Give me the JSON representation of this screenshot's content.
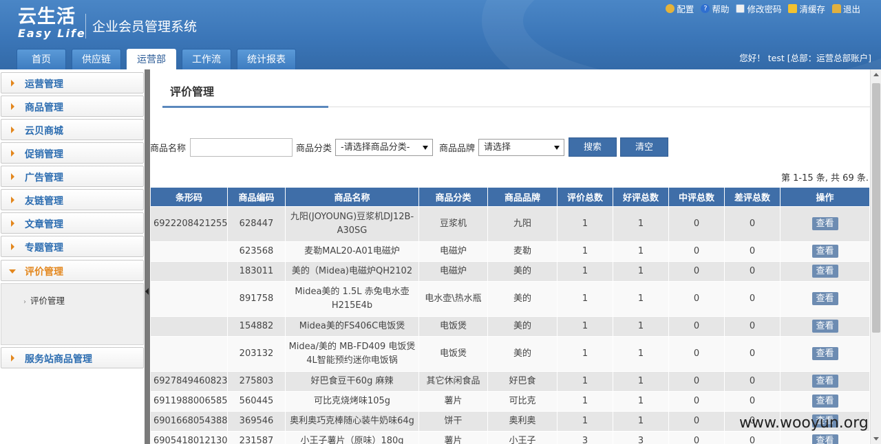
{
  "header": {
    "logo_cn": "云生活",
    "logo_en": "Easy Life",
    "system_title": "企业会员管理系统",
    "toplinks": [
      "配置",
      "帮助",
      "修改密码",
      "清缓存",
      "退出"
    ],
    "greeting": "您好！ test [总部：运营总部账户]",
    "tabs": [
      "首页",
      "供应链",
      "运营部",
      "工作流",
      "统计报表"
    ],
    "active_tab": "运营部"
  },
  "sidebar": {
    "items": [
      "运营管理",
      "商品管理",
      "云贝商城",
      "促销管理",
      "广告管理",
      "友链管理",
      "文章管理",
      "专题管理",
      "评价管理",
      "服务站商品管理"
    ],
    "open_item": "评价管理",
    "sub_items": [
      "评价管理"
    ]
  },
  "main": {
    "title": "评价管理",
    "filter": {
      "name_label": "商品名称",
      "name_value": "",
      "category_label": "商品分类",
      "category_value": "-请选择商品分类-",
      "brand_label": "商品品牌",
      "brand_value": "请选择",
      "search_button": "搜索",
      "clear_button": "清空"
    },
    "pager": "第 1-15 条, 共 69 条.",
    "table": {
      "headers": [
        "条形码",
        "商品编码",
        "商品名称",
        "商品分类",
        "商品品牌",
        "评价总数",
        "好评总数",
        "中评总数",
        "差评总数",
        "操作"
      ],
      "action_label": "查看",
      "rows": [
        {
          "barcode": "6922208421255",
          "code": "628447",
          "name": "九阳(JOYOUNG)豆浆机DJ12B-A30SG",
          "category": "豆浆机",
          "brand": "九阳",
          "total": "1",
          "good": "1",
          "mid": "0",
          "bad": "0"
        },
        {
          "barcode": "",
          "code": "623568",
          "name": "麦勒MAL20-A01电磁炉",
          "category": "电磁炉",
          "brand": "麦勒",
          "total": "1",
          "good": "1",
          "mid": "0",
          "bad": "0"
        },
        {
          "barcode": "",
          "code": "183011",
          "name": "美的（Midea)电磁炉QH2102",
          "category": "电磁炉",
          "brand": "美的",
          "total": "1",
          "good": "1",
          "mid": "0",
          "bad": "0"
        },
        {
          "barcode": "",
          "code": "891758",
          "name": "Midea美的 1.5L 赤兔电水壶 H215E4b",
          "category": "电水壶\\热水瓶",
          "brand": "美的",
          "total": "1",
          "good": "1",
          "mid": "0",
          "bad": "0"
        },
        {
          "barcode": "",
          "code": "154882",
          "name": "Midea美的FS406C电饭煲",
          "category": "电饭煲",
          "brand": "美的",
          "total": "1",
          "good": "1",
          "mid": "0",
          "bad": "0"
        },
        {
          "barcode": "",
          "code": "203132",
          "name": "Midea/美的 MB-FD409 电饭煲 4L智能预约迷你电饭锅",
          "category": "电饭煲",
          "brand": "美的",
          "total": "1",
          "good": "1",
          "mid": "0",
          "bad": "0"
        },
        {
          "barcode": "6927849460823",
          "code": "275803",
          "name": "好巴食豆干60g 麻辣",
          "category": "其它休闲食品",
          "brand": "好巴食",
          "total": "1",
          "good": "1",
          "mid": "0",
          "bad": "0"
        },
        {
          "barcode": "6911988006585",
          "code": "560445",
          "name": "可比克烧烤味105g",
          "category": "薯片",
          "brand": "可比克",
          "total": "1",
          "good": "1",
          "mid": "0",
          "bad": "0"
        },
        {
          "barcode": "6901668054388",
          "code": "369546",
          "name": "奥利奥巧克棒随心装牛奶味64g",
          "category": "饼干",
          "brand": "奥利奥",
          "total": "1",
          "good": "1",
          "mid": "0",
          "bad": "0"
        },
        {
          "barcode": "6905418012130",
          "code": "231587",
          "name": "小王子薯片（原味）180g",
          "category": "薯片",
          "brand": "小王子",
          "total": "3",
          "good": "3",
          "mid": "0",
          "bad": "0"
        }
      ]
    }
  },
  "watermark": "www.wooyun.org"
}
